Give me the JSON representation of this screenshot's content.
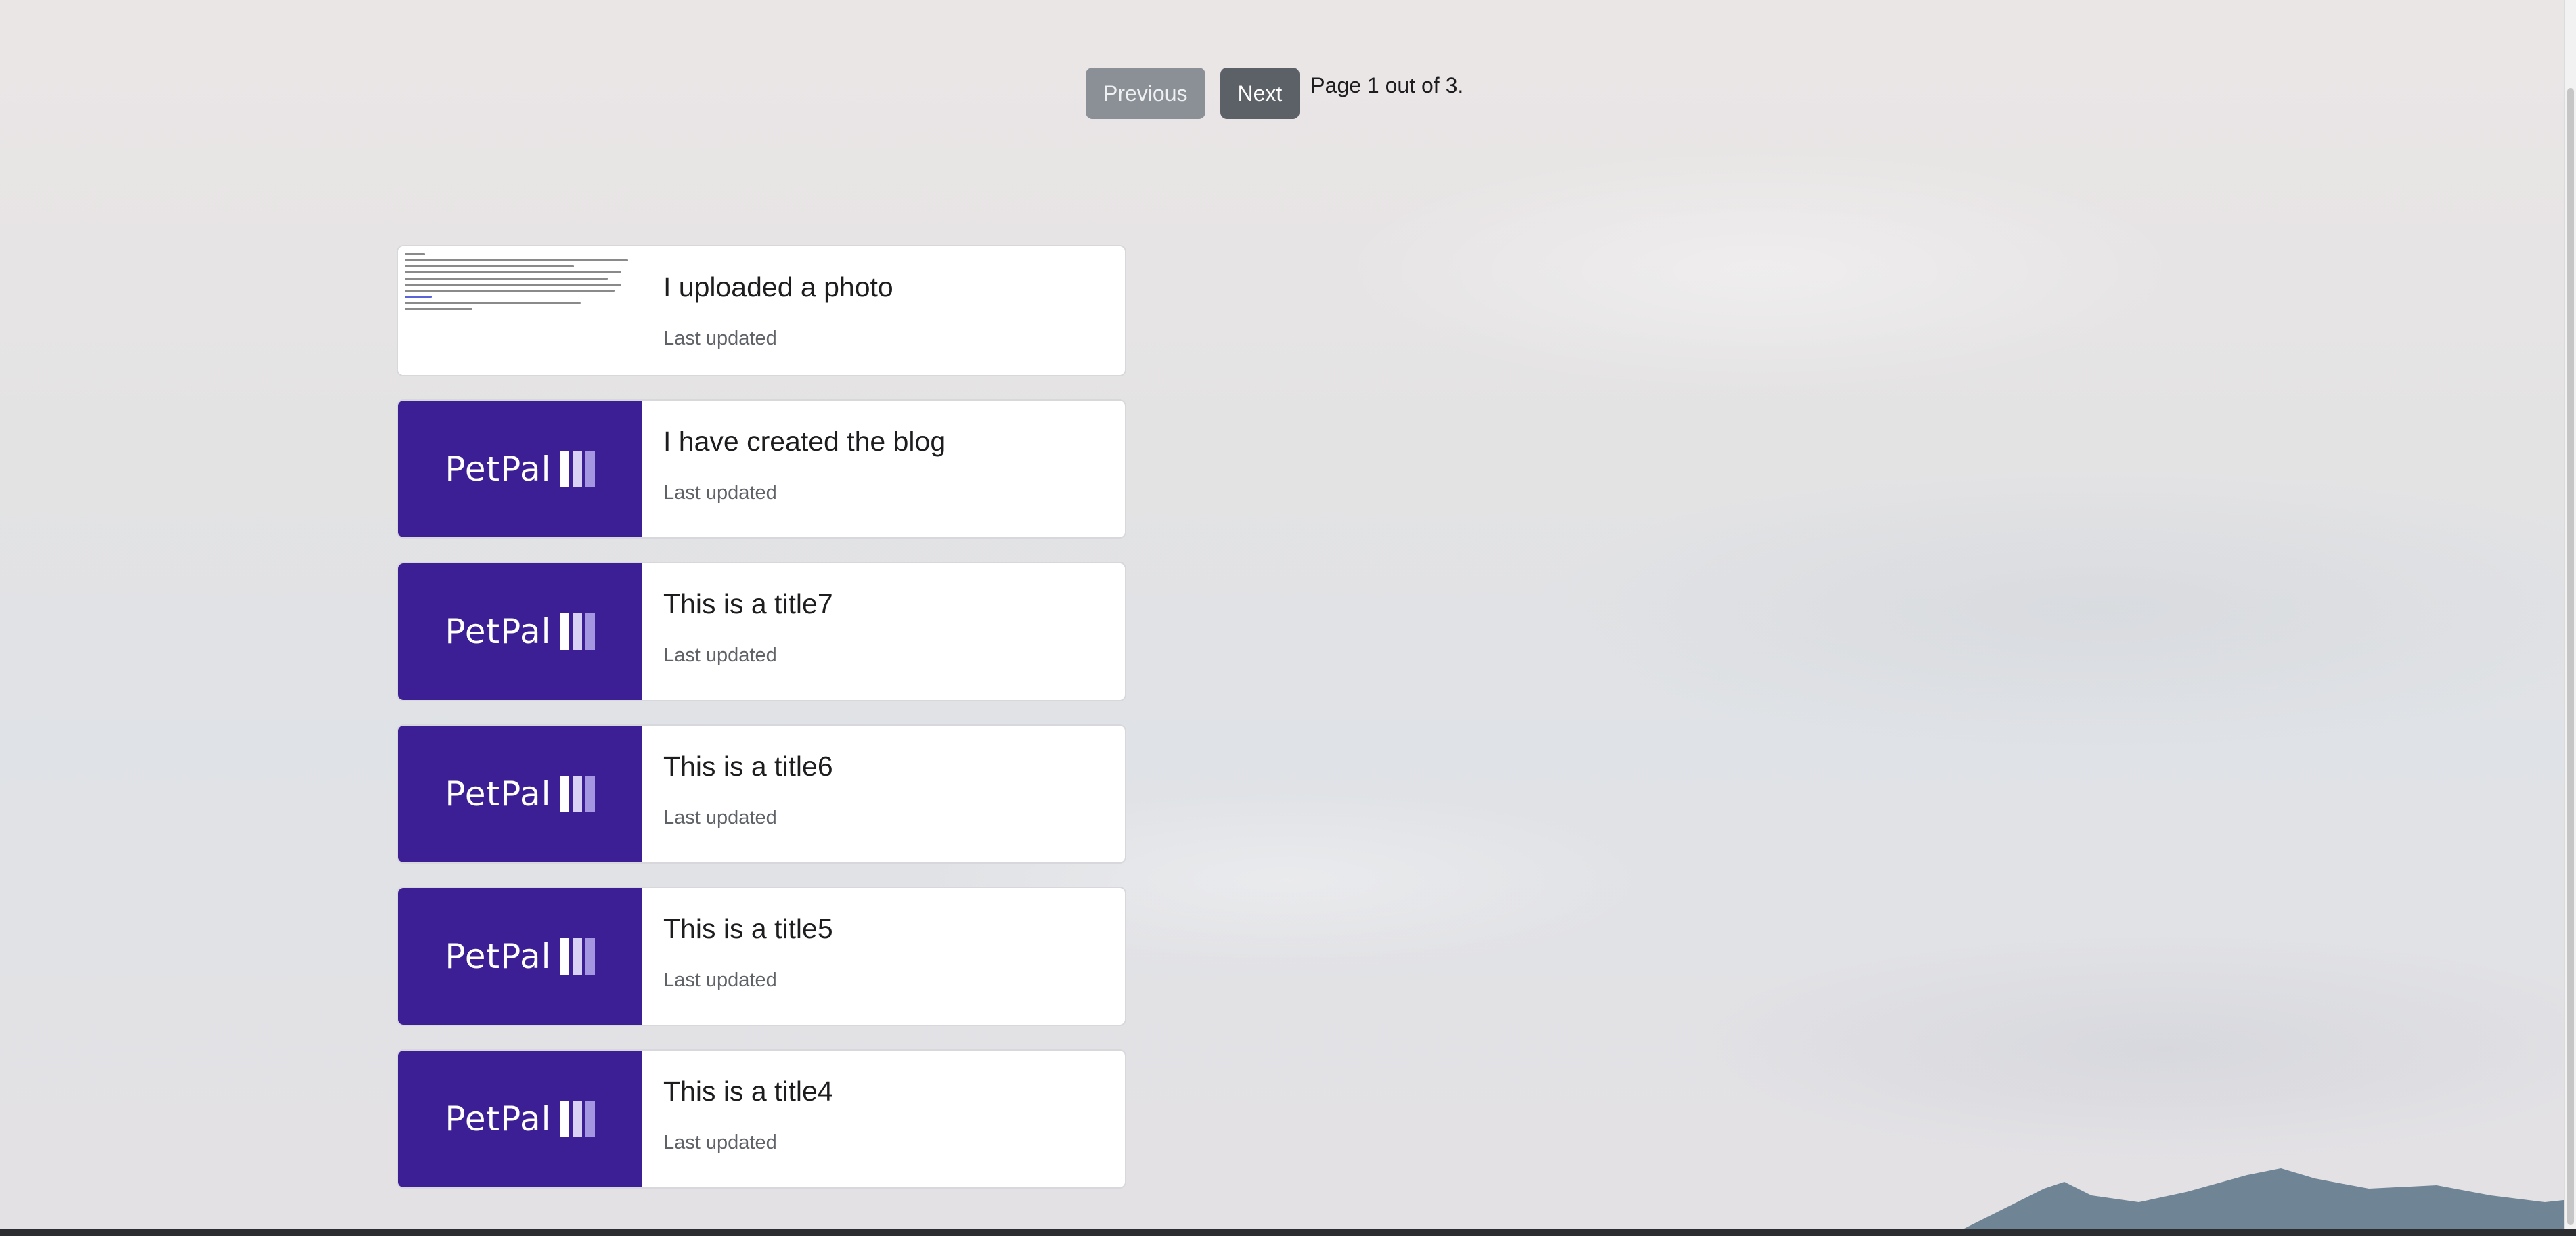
{
  "pagination": {
    "previous_label": "Previous",
    "next_label": "Next",
    "status_text": "Page 1 out of 3."
  },
  "posts": [
    {
      "title": "I uploaded a photo",
      "subtitle": "Last updated",
      "thumbnail": "document-screenshot"
    },
    {
      "title": "I have created the blog",
      "subtitle": "Last updated",
      "thumbnail": "petpal-logo"
    },
    {
      "title": "This is a title7",
      "subtitle": "Last updated",
      "thumbnail": "petpal-logo"
    },
    {
      "title": "This is a title6",
      "subtitle": "Last updated",
      "thumbnail": "petpal-logo"
    },
    {
      "title": "This is a title5",
      "subtitle": "Last updated",
      "thumbnail": "petpal-logo"
    },
    {
      "title": "This is a title4",
      "subtitle": "Last updated",
      "thumbnail": "petpal-logo"
    }
  ],
  "brand": {
    "logo_text": "PetPal",
    "logo_color": "#3c1f94"
  }
}
